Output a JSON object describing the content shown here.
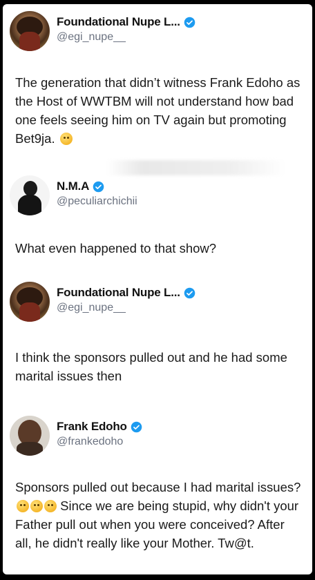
{
  "tweets": [
    {
      "name": "Foundational Nupe L...",
      "handle": "@egi_nupe__",
      "text": "The generation that didn’t witness Frank Edoho as the Host of WWTBM will not understand how bad one feels seeing him on TV again but promoting Bet9ja.",
      "emoji": "confused-face-emoji"
    },
    {
      "name": "N.M.A",
      "handle": "@peculiarchichii",
      "text": "What even happened to that show?"
    },
    {
      "name": "Foundational Nupe L...",
      "handle": "@egi_nupe__",
      "text": "I think the sponsors pulled out and he had some marital issues then"
    },
    {
      "name": "Frank Edoho",
      "handle": "@frankedoho",
      "text_before": "Sponsors pulled out because I had marital issues?",
      "emojis": [
        "rofl-emoji",
        "rofl-emoji",
        "rofl-emoji"
      ],
      "text_after": " Since we are being stupid, why didn't your Father pull out when you were conceived? After all, he didn't really like your Mother. Tw@t."
    }
  ],
  "colors": {
    "verified": "#1d9bf0",
    "handle": "#6b7280",
    "text": "#1a1a1a"
  }
}
